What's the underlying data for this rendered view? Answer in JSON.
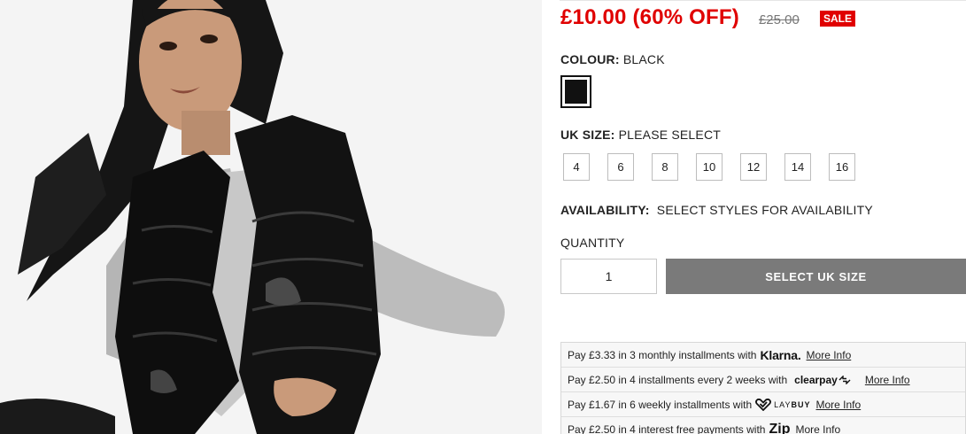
{
  "product": {
    "price_now": "£10.00 (60% OFF)",
    "price_was": "£25.00",
    "sale_badge": "SALE"
  },
  "colour": {
    "label": "COLOUR:",
    "value": "BLACK",
    "swatch_color": "#111111"
  },
  "size": {
    "label": "UK SIZE:",
    "value": "PLEASE SELECT",
    "options": [
      "4",
      "6",
      "8",
      "10",
      "12",
      "14",
      "16"
    ]
  },
  "availability": {
    "label": "AVAILABILITY:",
    "value": "SELECT STYLES FOR AVAILABILITY"
  },
  "quantity": {
    "label": "QUANTITY",
    "value": "1"
  },
  "cta": {
    "label": "SELECT UK SIZE",
    "color": "#7a7a7a"
  },
  "installments": [
    {
      "pay": "Pay",
      "amount": "£3.33",
      "text": "in 3 monthly installments with",
      "provider": "Klarna.",
      "link": "More Info"
    },
    {
      "pay": "Pay",
      "amount": "£2.50",
      "text": "in 4 installments every 2 weeks with",
      "provider": "clearpay",
      "link": "More Info"
    },
    {
      "pay": "Pay",
      "amount": "£1.67",
      "text": "in 6 weekly installments with",
      "provider_light": "LAY",
      "provider_bold": "BUY",
      "link": "More Info"
    },
    {
      "pay": "Pay",
      "amount": "£2.50",
      "text": "in 4 interest free payments with",
      "provider": "Zip",
      "link": "More Info"
    }
  ],
  "colors": {
    "sale_red": "#e00000",
    "background": "#ffffff",
    "image_background": "#f4f4f4"
  },
  "icons": {
    "clearpay": "clearpay-arrows-icon",
    "laybuy": "heart-check-icon"
  }
}
